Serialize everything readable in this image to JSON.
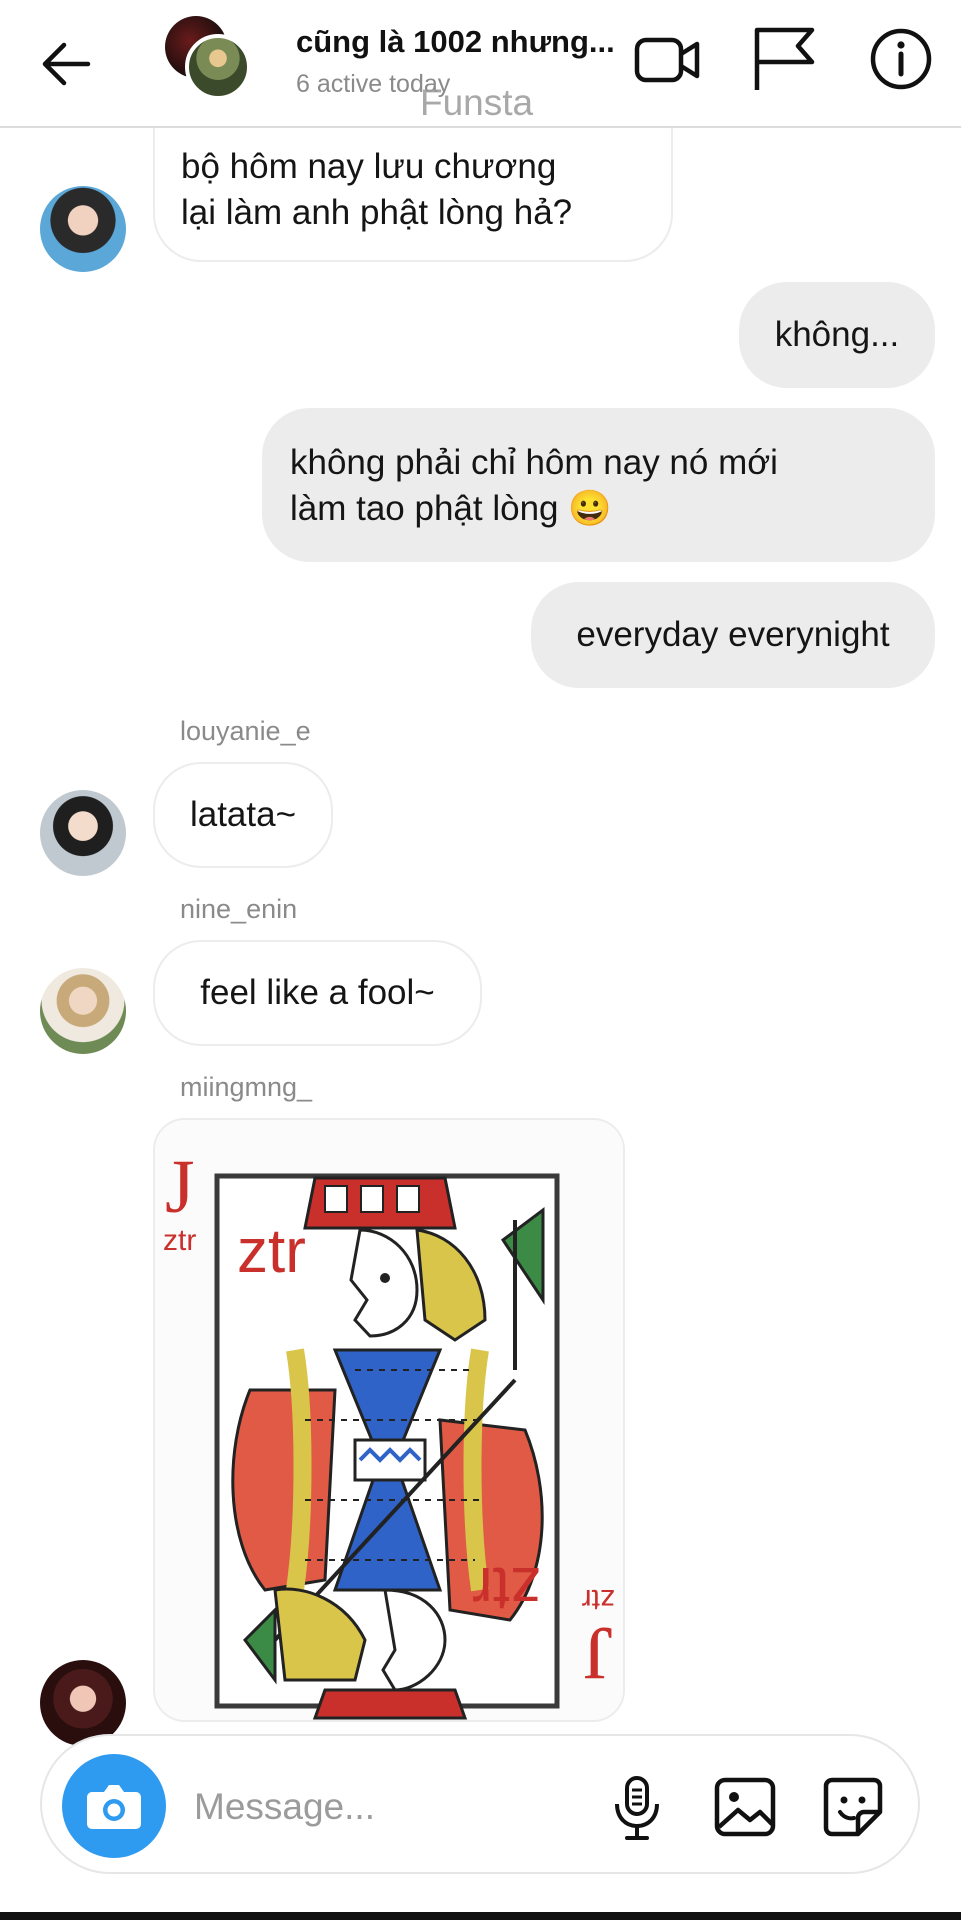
{
  "header": {
    "title": "cũng là 1002 nhưng...",
    "subtitle": "6 active today",
    "watermark": "Funsta"
  },
  "messages": [
    {
      "type": "incoming",
      "text_line1": "bộ hôm nay lưu chương",
      "text_line2": "lại làm anh phật lòng hả?"
    },
    {
      "type": "outgoing",
      "text": "không..."
    },
    {
      "type": "outgoing",
      "text_line1": "không phải chỉ hôm nay nó mới",
      "text_line2": "làm tao phật lòng 😀"
    },
    {
      "type": "outgoing",
      "text": "everyday everynight"
    },
    {
      "type": "incoming",
      "sender": "louyanie_e",
      "text": "latata~"
    },
    {
      "type": "incoming",
      "sender": "nine_enin",
      "text": "feel like a fool~"
    },
    {
      "type": "incoming",
      "sender": "miingmng_",
      "image": "jack-playing-card"
    }
  ],
  "card": {
    "rank_top": "J",
    "suit_top": "ztr",
    "face_text_top": "ztr",
    "rank_bottom": "J",
    "suit_bottom": "ztr",
    "face_text_bottom": "ztr"
  },
  "composer": {
    "placeholder": "Message..."
  },
  "icons": {
    "back": "arrow-left-icon",
    "video": "video-camera-icon",
    "flag": "flag-icon",
    "info": "info-icon",
    "camera": "camera-icon",
    "mic": "microphone-icon",
    "gallery": "image-icon",
    "sticker": "sticker-icon"
  },
  "colors": {
    "accent": "#2f9bf0",
    "outgoing_bubble": "#ececec"
  }
}
